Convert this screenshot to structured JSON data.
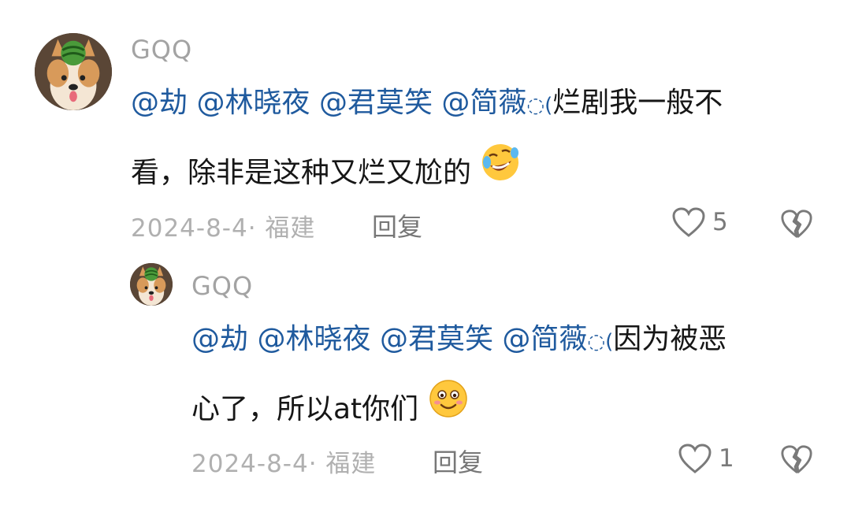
{
  "comments": [
    {
      "username": "GQQ",
      "mentions": [
        "@劫",
        "@林晓夜",
        "@君莫笑",
        "@简薇"
      ],
      "separator": "◌(",
      "text_line1": "烂剧我一般不",
      "text_line2": "看，除非是这种又烂又尬的",
      "emoji": "rofl-emoji",
      "date": "2024-8-4",
      "location": "· 福建",
      "reply_label": "回复",
      "likes": "5"
    },
    {
      "username": "GQQ",
      "mentions": [
        "@劫",
        "@林晓夜",
        "@君莫笑",
        "@简薇"
      ],
      "separator": "◌(",
      "text_line1": "因为被恶",
      "text_line2": "心了，所以at你们",
      "emoji": "smile-emoji",
      "date": "2024-8-4",
      "location": "· 福建",
      "reply_label": "回复",
      "likes": "1"
    }
  ]
}
